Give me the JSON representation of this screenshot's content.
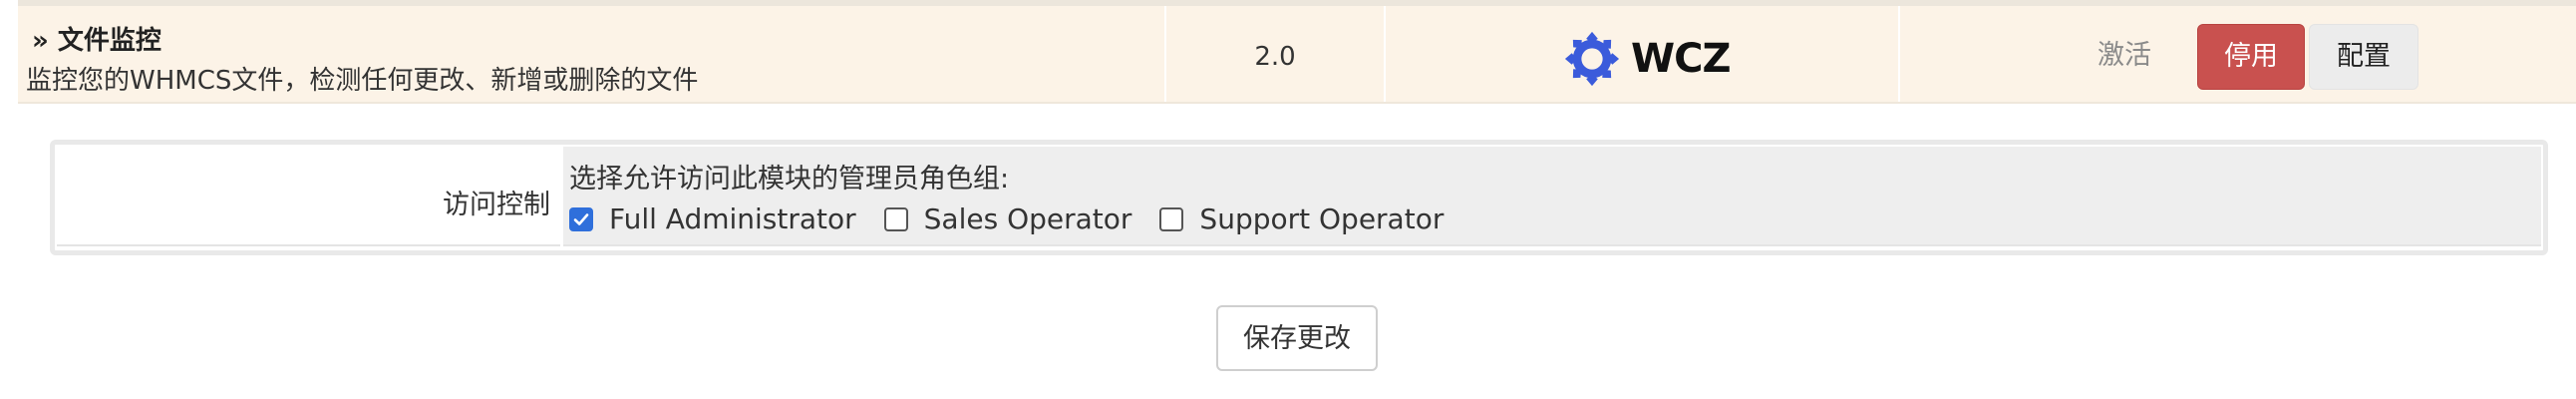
{
  "module": {
    "title": "» 文件监控",
    "description": "监控您的WHMCS文件，检测任何更改、新增或删除的文件",
    "version": "2.0",
    "logo": {
      "text": "WCZ",
      "icon": "wcz-gear-logo-icon",
      "color": "#3b5bdb"
    },
    "actions": {
      "activate_label": "激活",
      "disable_label": "停用",
      "configure_label": "配置",
      "disable_color": "#c9514f"
    }
  },
  "access_control": {
    "label": "访问控制",
    "prompt": "选择允许访问此模块的管理员角色组:",
    "roles": [
      {
        "name": "Full Administrator",
        "checked": true
      },
      {
        "name": "Sales Operator",
        "checked": false
      },
      {
        "name": "Support Operator",
        "checked": false
      }
    ]
  },
  "save_label": "保存更改"
}
